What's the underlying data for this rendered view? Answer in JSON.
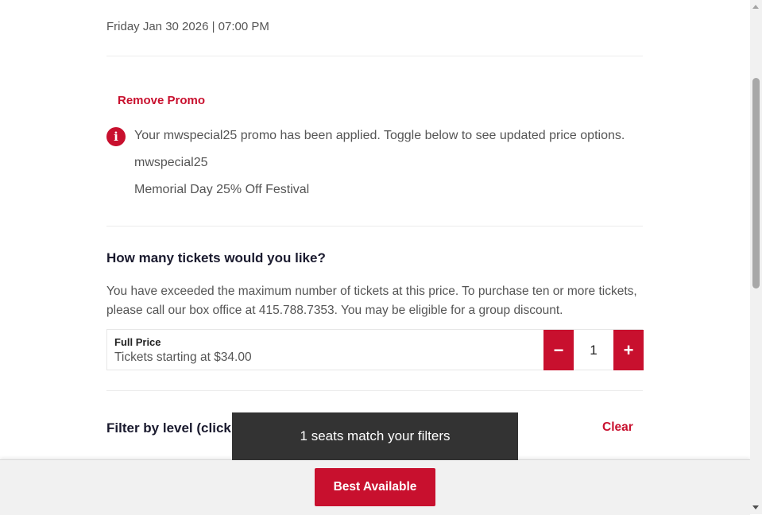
{
  "event": {
    "date_time": "Friday Jan 30 2026 | 07:00 PM"
  },
  "promo": {
    "remove_label": "Remove Promo",
    "info_icon": "info-icon",
    "message": "Your mwspecial25 promo has been applied. Toggle below to see updated price options.",
    "code": "mwspecial25",
    "description": "Memorial Day 25% Off Festival"
  },
  "tickets": {
    "heading": "How many tickets would you like?",
    "notice": "You have exceeded the maximum number of tickets at this price. To purchase ten or more tickets, please call our box office at 415.788.7353. You may be eligible for a group discount.",
    "rows": [
      {
        "type": "Full Price",
        "price": "Tickets starting at $34.00",
        "quantity": "1",
        "minus_label": "−",
        "plus_label": "+"
      }
    ]
  },
  "filter": {
    "label": "Filter by level (click",
    "clear_label": "Clear"
  },
  "toast": {
    "message": "1 seats match your filters"
  },
  "bottom_bar": {
    "best_available_label": "Best Available"
  },
  "colors": {
    "accent": "#c8102e",
    "toast_bg": "#333333",
    "bar_bg": "#f1f1f1"
  }
}
